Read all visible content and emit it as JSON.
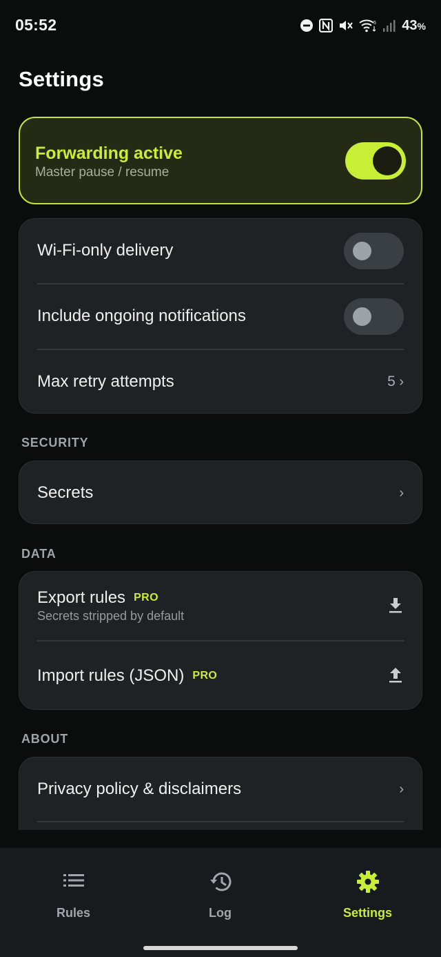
{
  "status_bar": {
    "time": "05:52",
    "battery_percent": "43",
    "battery_unit": "%",
    "icons": [
      "dnd-icon",
      "nfc-icon",
      "mute-icon",
      "wifi-icon",
      "signal-icon"
    ]
  },
  "page": {
    "title": "Settings"
  },
  "master": {
    "title": "Forwarding active",
    "subtitle": "Master pause / resume",
    "enabled": true
  },
  "general": {
    "wifi_only": {
      "label": "Wi-Fi-only delivery",
      "enabled": false
    },
    "ongoing": {
      "label": "Include ongoing notifications",
      "enabled": false
    },
    "max_retry": {
      "label": "Max retry attempts",
      "value": "5",
      "chevron": "›"
    }
  },
  "security": {
    "header": "SECURITY",
    "secrets": {
      "label": "Secrets",
      "chevron": "›"
    }
  },
  "data_section": {
    "header": "DATA",
    "export": {
      "label": "Export rules",
      "badge": "PRO",
      "subtitle": "Secrets stripped by default",
      "icon": "download-icon"
    },
    "import": {
      "label": "Import rules (JSON)",
      "badge": "PRO",
      "icon": "upload-icon"
    }
  },
  "about": {
    "header": "ABOUT",
    "privacy": {
      "label": "Privacy policy & disclaimers",
      "chevron": "›"
    }
  },
  "bottom_nav": {
    "items": [
      {
        "label": "Rules",
        "icon": "list-icon",
        "active": false
      },
      {
        "label": "Log",
        "icon": "history-icon",
        "active": false
      },
      {
        "label": "Settings",
        "icon": "gear-icon",
        "active": true
      }
    ]
  },
  "colors": {
    "accent": "#c8ee35",
    "background": "#0b0c0c",
    "card": "#1f2225",
    "master_card": "#252a14"
  }
}
